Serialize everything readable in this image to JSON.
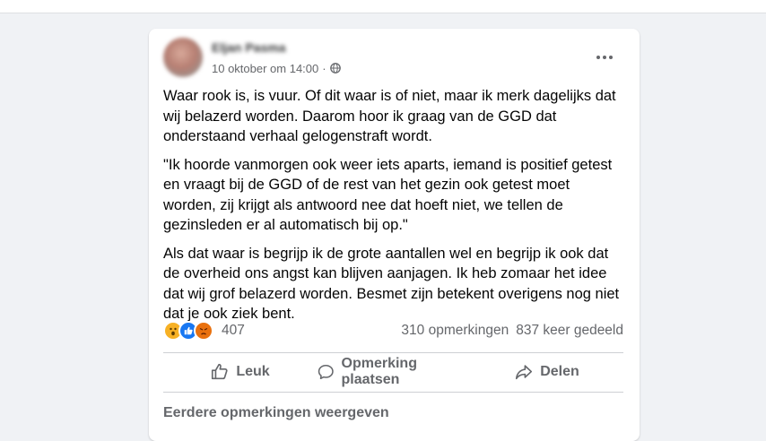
{
  "post": {
    "author": "Eljan Pasma",
    "date": "10 oktober om 14:00",
    "separator": "·",
    "audience_icon": "globe-icon",
    "more_icon": "more-options-icon",
    "paragraphs": [
      "Waar rook is, is vuur. Of dit waar is of niet, maar ik merk dagelijks dat\nwij belazerd worden. Daarom hoor ik graag van de GGD dat\nonderstaand verhaal gelogenstraft wordt.",
      "\"Ik hoorde vanmorgen ook weer iets aparts, iemand is positief getest\nen vraagt bij de GGD of de rest van het gezin ook getest moet\nworden, zij krijgt als antwoord nee dat hoeft niet, we tellen de\ngezinsleden er al automatisch bij op.\"",
      "Als dat waar is begrijp ik de grote aantallen wel en begrijp ik ook dat\nde overheid ons angst kan blijven aanjagen. Ik heb zomaar het idee\ndat wij grof belazerd worden. Besmet zijn betekent overigens nog niet\ndat je ook ziek bent."
    ],
    "reactions": {
      "icons": [
        "wow-icon",
        "like-icon",
        "angry-icon"
      ],
      "count": "407"
    },
    "comments_count": "310 opmerkingen",
    "shares_count": "837 keer gedeeld",
    "actions": {
      "like": "Leuk",
      "comment": "Opmerking plaatsen",
      "share": "Delen"
    },
    "earlier_comments": "Eerdere opmerkingen weergeven"
  },
  "colors": {
    "background": "#f0f2f5",
    "card": "#ffffff",
    "secondary_text": "#65676b",
    "like_blue": "#1877f2",
    "wow_yellow": "#f7b125",
    "angry_orange": "#e9710f"
  }
}
